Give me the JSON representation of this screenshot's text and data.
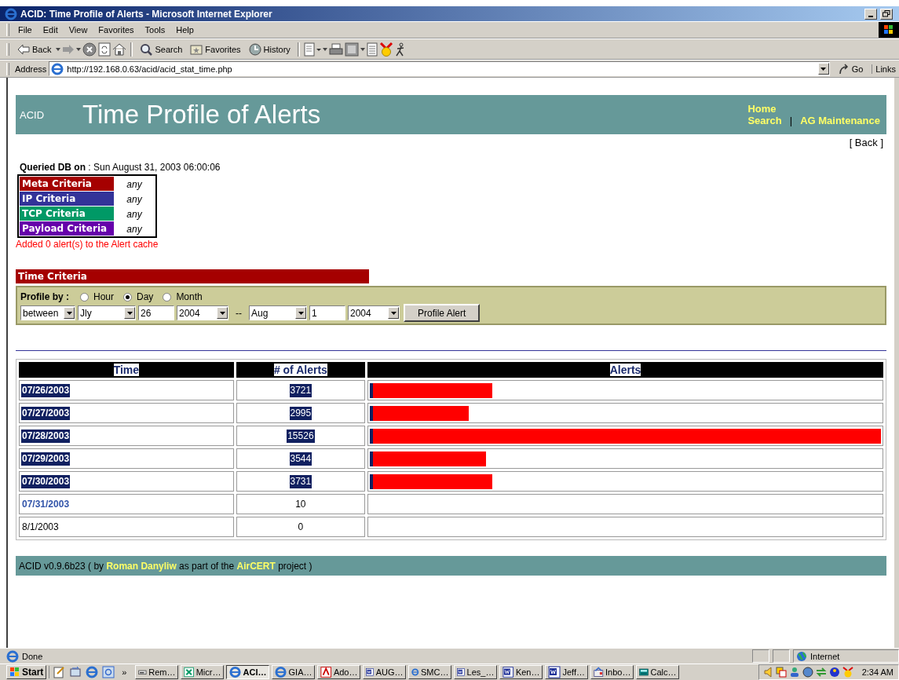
{
  "window": {
    "title": "ACID: Time Profile of Alerts - Microsoft Internet Explorer"
  },
  "menu": [
    "File",
    "Edit",
    "View",
    "Favorites",
    "Tools",
    "Help"
  ],
  "toolbar": [
    {
      "kind": "back",
      "label": "Back"
    },
    {
      "kind": "forward"
    },
    {
      "kind": "stop"
    },
    {
      "kind": "refresh"
    },
    {
      "kind": "home"
    },
    {
      "kind": "search",
      "label": "Search"
    },
    {
      "kind": "favorites",
      "label": "Favorites"
    },
    {
      "kind": "history",
      "label": "History"
    },
    {
      "kind": "edit"
    },
    {
      "kind": "print"
    },
    {
      "kind": "media"
    },
    {
      "kind": "notes"
    },
    {
      "kind": "messenger"
    },
    {
      "kind": "runner"
    }
  ],
  "address": {
    "label": "Address",
    "value": "http://192.168.0.63/acid/acid_stat_time.php",
    "go": "Go",
    "links": "Links"
  },
  "page": {
    "brand": "ACID",
    "title": "Time Profile of Alerts",
    "nav": {
      "home": "Home",
      "search": "Search",
      "separator": "|",
      "maintenance": "AG Maintenance"
    },
    "back_link": "[ Back ]",
    "queried": "**Queried DB on** : Sun August 31, 2003 06:00:06",
    "criteria": [
      {
        "label": "Meta Criteria",
        "value": "any",
        "color": "#a50000"
      },
      {
        "label": "IP Criteria",
        "value": "any",
        "color": "#333399"
      },
      {
        "label": "TCP Criteria",
        "value": "any",
        "color": "#009966"
      },
      {
        "label": "Payload Criteria",
        "value": "any",
        "color": "#6600aa"
      }
    ],
    "cache_message": "Added 0 alert(s) to the Alert cache",
    "time_criteria": {
      "title": "Time Criteria",
      "profile_label": "Profile by :",
      "options": [
        {
          "label": "Hour",
          "selected": false
        },
        {
          "label": "Day",
          "selected": true
        },
        {
          "label": "Month",
          "selected": false
        }
      ],
      "fields": [
        {
          "kind": "select",
          "value": "between"
        },
        {
          "kind": "select",
          "value": "Jly"
        },
        {
          "kind": "input",
          "value": "26"
        },
        {
          "kind": "select",
          "value": "2004"
        },
        {
          "kind": "text",
          "value": "--"
        },
        {
          "kind": "select",
          "value": "Aug"
        },
        {
          "kind": "input",
          "value": "1"
        },
        {
          "kind": "select",
          "value": "2004"
        }
      ],
      "button": "Profile Alert"
    },
    "table": {
      "columns": [
        "Time",
        "# of Alerts",
        "Alerts"
      ],
      "rows": [
        {
          "time": "07/26/2003",
          "count": "3721",
          "link": true,
          "selected": true,
          "level": 0.24
        },
        {
          "time": "07/27/2003",
          "count": "2995",
          "link": true,
          "selected": true,
          "level": 0.193
        },
        {
          "time": "07/28/2003",
          "count": "15526",
          "link": true,
          "selected": true,
          "level": 1
        },
        {
          "time": "07/29/2003",
          "count": "3544",
          "link": true,
          "selected": true,
          "level": 0.228
        },
        {
          "time": "07/30/2003",
          "count": "3731",
          "link": true,
          "selected": true,
          "level": 0.24
        },
        {
          "time": "07/31/2003",
          "count": "10",
          "link": true,
          "selected": false
        },
        {
          "time": "8/1/2003",
          "count": "0",
          "link": false,
          "selected": false
        }
      ]
    },
    "footer": {
      "prefix": "ACID v0.9.6b23 ( by",
      "author": "Roman Danyliw",
      "middle": "as part of the",
      "project": "AirCERT",
      "suffix": "project )"
    }
  },
  "status": {
    "text": "Done",
    "zone": "Internet"
  },
  "taskbar": {
    "start": "Start",
    "more": "»",
    "tasks": [
      {
        "label": "Rem…",
        "kind": "generic",
        "selected": false
      },
      {
        "label": "Micr…",
        "kind": "excel",
        "selected": false
      },
      {
        "label": "ACI…",
        "kind": "ie",
        "selected": true
      },
      {
        "label": "GIA…",
        "kind": "ie",
        "selected": false
      },
      {
        "label": "Ado…",
        "kind": "acrobat",
        "selected": false
      },
      {
        "label": "AUG…",
        "kind": "word",
        "selected": false
      },
      {
        "label": "SMC…",
        "kind": "ie",
        "selected": false
      },
      {
        "label": "Les_…",
        "kind": "word",
        "selected": false
      },
      {
        "label": "Ken…",
        "kind": "word",
        "selected": false
      },
      {
        "label": "Jeff…",
        "kind": "word",
        "selected": false
      },
      {
        "label": "Inbo…",
        "kind": "outlook",
        "selected": false
      },
      {
        "label": "Calc…",
        "kind": "calculator",
        "selected": false
      }
    ],
    "clock": "2:34 AM"
  }
}
